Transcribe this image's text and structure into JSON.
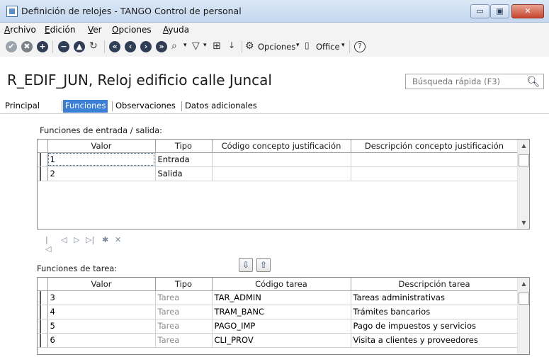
{
  "window": {
    "title": "Definición de relojes - TANGO Control de personal",
    "minimize": "▭",
    "maximize": "▣",
    "close": "✕"
  },
  "menu": [
    "Archivo",
    "Edición",
    "Ver",
    "Opciones",
    "Ayuda"
  ],
  "toolbar": {
    "opciones_label": "Opciones",
    "office_label": "Office",
    "help_glyph": "?",
    "dropdown_glyph": "▾"
  },
  "record": {
    "title": "R_EDIF_JUN, Reloj edificio calle Juncal"
  },
  "search": {
    "placeholder": "Búsqueda rápida (F3)",
    "icon": "search-icon"
  },
  "tabs": [
    "Principal",
    "Funciones",
    "Observaciones",
    "Datos adicionales"
  ],
  "active_tab": "Funciones",
  "entrada_salida": {
    "label": "Funciones de entrada / salida:",
    "columns": [
      "Valor",
      "Tipo",
      "Código concepto justificación",
      "Descripción concepto justificación"
    ],
    "rows": [
      [
        "1",
        "Entrada",
        "",
        ""
      ],
      [
        "2",
        "Salida",
        "",
        ""
      ]
    ]
  },
  "navigator": [
    "|◁",
    "◁",
    "▷",
    "▷|",
    "✱",
    "✕"
  ],
  "move_buttons": [
    "⇩",
    "⇧"
  ],
  "tareas": {
    "label": "Funciones de tarea:",
    "columns": [
      "Valor",
      "Tipo",
      "Código tarea",
      "Descripción tarea"
    ],
    "rows": [
      [
        "3",
        "Tarea",
        "TAR_ADMIN",
        "Tareas administrativas"
      ],
      [
        "4",
        "Tarea",
        "TRAM_BANC",
        "Trámites bancarios"
      ],
      [
        "5",
        "Tarea",
        "PAGO_IMP",
        "Pago de impuestos y servicios"
      ],
      [
        "6",
        "Tarea",
        "CLI_PROV",
        "Visita a clientes y proveedores"
      ]
    ]
  },
  "colors": {
    "accent": "#3b7fd6",
    "titlebar": "#c4d7ee",
    "close_button": "#c7452e"
  }
}
